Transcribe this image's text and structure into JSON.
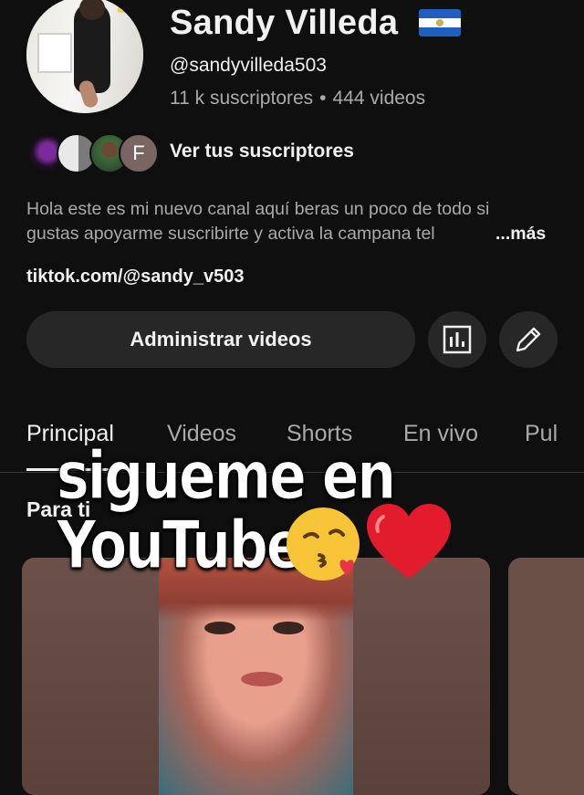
{
  "channel": {
    "name": "Sandy Villeda",
    "handle": "@sandyvilleda503",
    "subscribers": "11 k suscriptores",
    "videos": "444 videos",
    "stats_separator": "•"
  },
  "subscribers_link": {
    "label": "Ver tus suscriptores",
    "avatar_letter": "F"
  },
  "description": {
    "line1": "Hola este es mi nuevo canal aquí beras un poco de todo si",
    "line2": "gustas apoyarme suscribirte y activa la campana tel",
    "more": "...más",
    "link": "tiktok.com/@sandy_v503"
  },
  "actions": {
    "manage_label": "Administrar videos"
  },
  "tabs": [
    {
      "label": "Principal"
    },
    {
      "label": "Videos"
    },
    {
      "label": "Shorts"
    },
    {
      "label": "En vivo"
    },
    {
      "label": "Pul"
    }
  ],
  "section": {
    "title": "Para ti"
  },
  "overlay": {
    "line1": "sigueme en",
    "line2": "YouTube"
  },
  "icons": {
    "analytics": "bar-chart-icon",
    "edit": "pencil-icon",
    "flag": "el-salvador-flag-icon",
    "emoji_kiss": "face-blowing-kiss-icon",
    "emoji_heart": "red-heart-icon"
  },
  "colors": {
    "background": "#0f0f0f",
    "button": "#272727",
    "text_primary": "#f1f1f1",
    "text_secondary": "#aaaaaa"
  }
}
